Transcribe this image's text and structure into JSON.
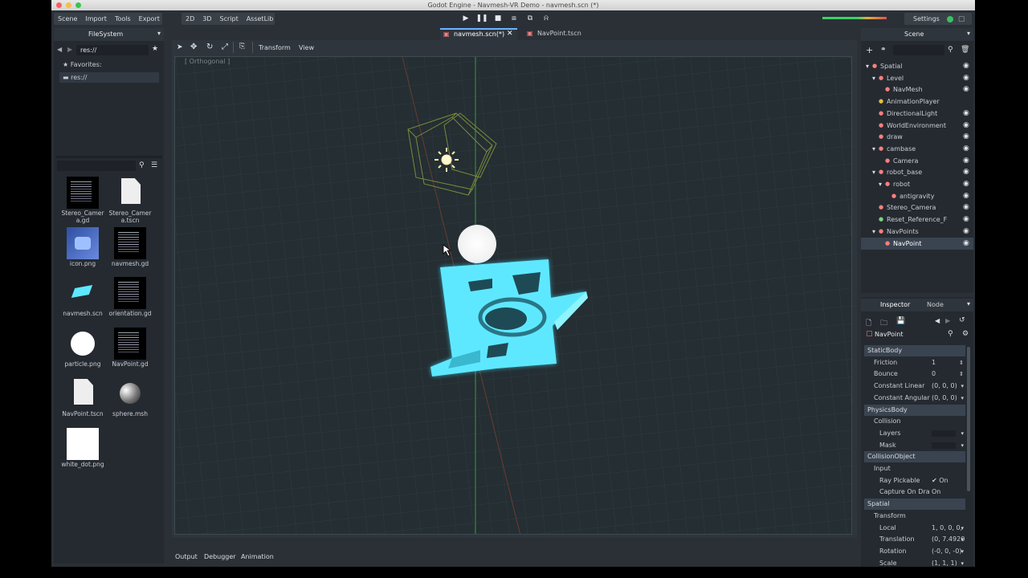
{
  "window": {
    "title": "Godot Engine - Navmesh-VR Demo - navmesh.scn (*)"
  },
  "menubar": {
    "left_menu": [
      "Scene",
      "Import",
      "Tools",
      "Export"
    ],
    "mode_menu": [
      "2D",
      "3D",
      "Script",
      "AssetLib"
    ],
    "settings_label": "Settings"
  },
  "playbar": {
    "icons": [
      "play-icon",
      "pause-icon",
      "stop-icon",
      "play-scene-icon",
      "play-custom-icon",
      "remote-icon"
    ]
  },
  "editor_tabs": [
    {
      "label": "navmesh.scn(*)",
      "active": true
    },
    {
      "label": "NavPoint.tscn",
      "active": false
    }
  ],
  "filesystem": {
    "title": "FileSystem",
    "path": "res://",
    "favorites_label": "Favorites:",
    "res_label": "res://",
    "files": [
      {
        "name": "Stereo_Camer\na.gd",
        "kind": "script"
      },
      {
        "name": "Stereo_Camer\na.tscn",
        "kind": "scene-doc"
      },
      {
        "name": "icon.png",
        "kind": "image-icon"
      },
      {
        "name": "navmesh.gd",
        "kind": "script"
      },
      {
        "name": "navmesh.scn",
        "kind": "mesh-scene"
      },
      {
        "name": "orientation.gd",
        "kind": "script"
      },
      {
        "name": "particle.png",
        "kind": "image-particle"
      },
      {
        "name": "NavPoint.gd",
        "kind": "script"
      },
      {
        "name": "NavPoint.tscn",
        "kind": "scene-doc"
      },
      {
        "name": "sphere.msh",
        "kind": "sphere"
      },
      {
        "name": "white_dot.png",
        "kind": "image-white"
      }
    ]
  },
  "viewport": {
    "toolbar": {
      "transform_label": "Transform",
      "view_label": "View"
    },
    "view_mode": "[ Orthogonal ]"
  },
  "bottom_tabs": [
    "Output",
    "Debugger",
    "Animation"
  ],
  "scene_panel": {
    "title": "Scene",
    "nodes": [
      {
        "label": "Spatial",
        "depth": 0,
        "expanded": true,
        "icon_color": "#fc7f7f"
      },
      {
        "label": "Level",
        "depth": 1,
        "expanded": true,
        "icon_color": "#fc7f7f"
      },
      {
        "label": "NavMesh",
        "depth": 2,
        "icon_color": "#fc7f7f"
      },
      {
        "label": "AnimationPlayer",
        "depth": 1,
        "icon_color": "#e0c040"
      },
      {
        "label": "DirectionalLight",
        "depth": 1,
        "icon_color": "#fc7f7f"
      },
      {
        "label": "WorldEnvironment",
        "depth": 1,
        "icon_color": "#fc7f7f"
      },
      {
        "label": "draw",
        "depth": 1,
        "icon_color": "#fc7f7f"
      },
      {
        "label": "cambase",
        "depth": 1,
        "expanded": true,
        "icon_color": "#fc7f7f"
      },
      {
        "label": "Camera",
        "depth": 2,
        "icon_color": "#fc7f7f"
      },
      {
        "label": "robot_base",
        "depth": 1,
        "expanded": true,
        "icon_color": "#fc7f7f"
      },
      {
        "label": "robot",
        "depth": 2,
        "expanded": true,
        "icon_color": "#fc7f7f"
      },
      {
        "label": "antigravity",
        "depth": 3,
        "icon_color": "#fc7f7f"
      },
      {
        "label": "Stereo_Camera",
        "depth": 1,
        "icon_color": "#fc7f7f"
      },
      {
        "label": "Reset_Reference_F",
        "depth": 1,
        "icon_color": "#7fd07f"
      },
      {
        "label": "NavPoints",
        "depth": 1,
        "expanded": true,
        "icon_color": "#fc7f7f"
      },
      {
        "label": "NavPoint",
        "depth": 2,
        "selected": true,
        "icon_color": "#fc7f7f"
      }
    ]
  },
  "inspector": {
    "tabs": [
      "Inspector",
      "Node"
    ],
    "object_name": "NavPoint",
    "rows": [
      {
        "type": "category",
        "label": "StaticBody"
      },
      {
        "type": "prop",
        "label": "Friction",
        "value": "1",
        "spin": true
      },
      {
        "type": "prop",
        "label": "Bounce",
        "value": "0",
        "spin": true
      },
      {
        "type": "prop",
        "label": "Constant Linear",
        "value": "(0, 0, 0)",
        "dropdown": true
      },
      {
        "type": "prop",
        "label": "Constant Angular",
        "value": "(0, 0, 0)",
        "dropdown": true
      },
      {
        "type": "category",
        "label": "PhysicsBody"
      },
      {
        "type": "sub",
        "label": "Collision"
      },
      {
        "type": "prop2",
        "label": "Layers",
        "value": "",
        "dropdown": true
      },
      {
        "type": "prop2",
        "label": "Mask",
        "value": "",
        "dropdown": true
      },
      {
        "type": "category",
        "label": "CollisionObject"
      },
      {
        "type": "sub",
        "label": "Input"
      },
      {
        "type": "prop2",
        "label": "Ray Pickable",
        "value": "✔ On"
      },
      {
        "type": "prop2",
        "label": "Capture On Dra",
        "value": "On"
      },
      {
        "type": "category",
        "label": "Spatial"
      },
      {
        "type": "sub",
        "label": "Transform"
      },
      {
        "type": "prop2",
        "label": "Local",
        "value": "1, 0, 0, 0,",
        "dropdown": true
      },
      {
        "type": "prop2",
        "label": "Translation",
        "value": "(0, 7.4920",
        "dropdown": true
      },
      {
        "type": "prop2",
        "label": "Rotation",
        "value": "(-0, 0, -0)",
        "dropdown": true
      },
      {
        "type": "prop2",
        "label": "Scale",
        "value": "(1, 1, 1)",
        "dropdown": true
      }
    ]
  }
}
